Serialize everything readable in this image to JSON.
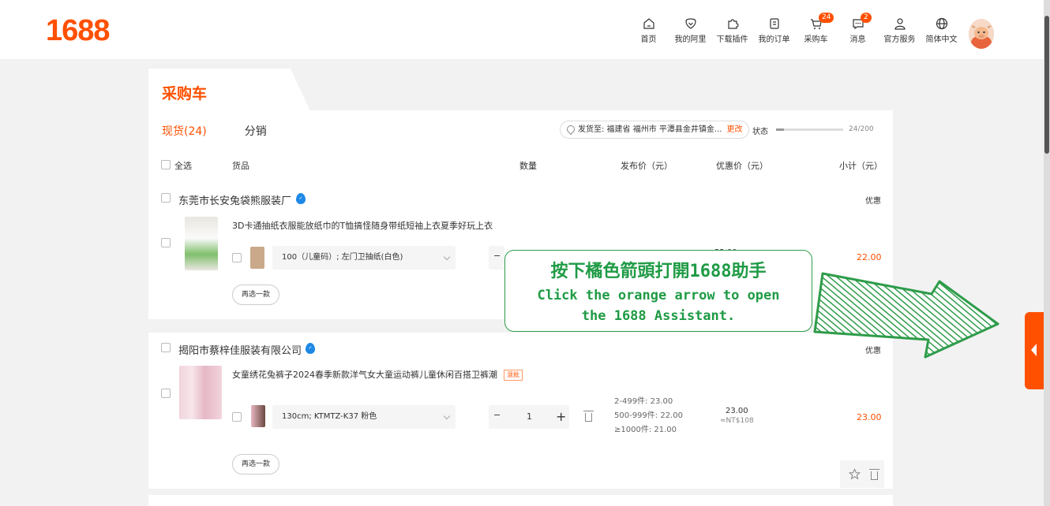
{
  "header": {
    "logo": "1688",
    "nav": [
      {
        "label": "首页",
        "icon": "home-icon"
      },
      {
        "label": "我的阿里",
        "icon": "heart-shield-icon"
      },
      {
        "label": "下载插件",
        "icon": "puzzle-icon"
      },
      {
        "label": "我的订单",
        "icon": "order-icon"
      },
      {
        "label": "采购车",
        "icon": "cart-icon",
        "badge": "24"
      },
      {
        "label": "消息",
        "icon": "message-icon",
        "badge": "2"
      },
      {
        "label": "官方服务",
        "icon": "user-icon"
      },
      {
        "label": "简体中文",
        "icon": "globe-icon"
      }
    ]
  },
  "page": {
    "title": "采购车",
    "subtabs": {
      "active": "现货(24)",
      "other": "分销"
    },
    "shipping": {
      "label": "发货至: 福建省 福州市 平潭县金井镇金...",
      "change": "更改"
    },
    "status": {
      "label": "状态",
      "count": "24/200",
      "progress": 0.12
    }
  },
  "columns": {
    "select_all": "全选",
    "product": "货品",
    "quantity": "数量",
    "list_price": "发布价（元）",
    "promo_price": "优惠价（元）",
    "subtotal": "小计（元）"
  },
  "stores": [
    {
      "name": "东莞市长安兔袋熊服装厂",
      "promo": "优惠",
      "product_title": "3D卡通抽纸衣服能放纸巾的T恤搞怪随身带纸短袖上衣夏季好玩上衣",
      "sku": "100（儿童码）; 左门卫抽纸(白色)",
      "promo_price": "22.00",
      "subtotal": "22.00",
      "reselect": "再选一款"
    },
    {
      "name": "揭阳市蔡梓佳服装有限公司",
      "promo": "优惠",
      "product_title": "女童绣花兔裤子2024春季新款洋气女大童运动裤儿童休闲百搭卫裤潮",
      "tag": "混批",
      "sku": "130cm; KTMTZ-K37 粉色",
      "quantity": "1",
      "tiers": [
        "2-499件: 23.00",
        "500-999件: 22.00",
        "≥1000件: 21.00"
      ],
      "promo_price": "23.00",
      "promo_price_twd": "≈NT$108",
      "subtotal": "23.00",
      "reselect": "再选一款"
    }
  ],
  "tutorial": {
    "zh": "按下橘色箭頭打開1688助手",
    "en_line1": "Click the orange arrow to open",
    "en_line2": "the 1688 Assistant."
  },
  "colors": {
    "brand": "#ff5000",
    "tutorial_green": "#1f9b45"
  }
}
